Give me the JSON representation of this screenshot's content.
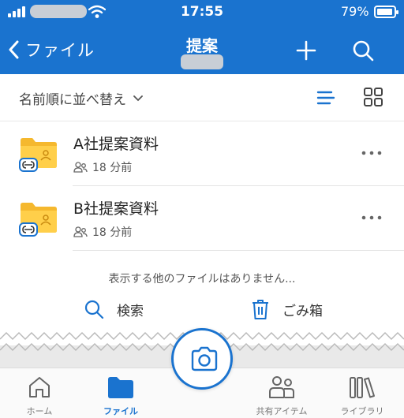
{
  "status": {
    "time": "17:55",
    "battery": "79%"
  },
  "header": {
    "back_label": "ファイル",
    "title": "提案"
  },
  "sort": {
    "label": "名前順に並べ替え"
  },
  "items": [
    {
      "name": "A社提案資料",
      "modified": "18 分前"
    },
    {
      "name": "B社提案資料",
      "modified": "18 分前"
    }
  ],
  "empty_note": "表示する他のファイルはありません...",
  "actions": {
    "search": "検索",
    "trash": "ごみ箱"
  },
  "tabs": [
    {
      "label": "ホーム"
    },
    {
      "label": "ファイル"
    },
    {
      "label": "共有アイテム"
    },
    {
      "label": "ライブラリ"
    }
  ],
  "colors": {
    "accent": "#1a73cf",
    "folder": "#f5b82e"
  }
}
